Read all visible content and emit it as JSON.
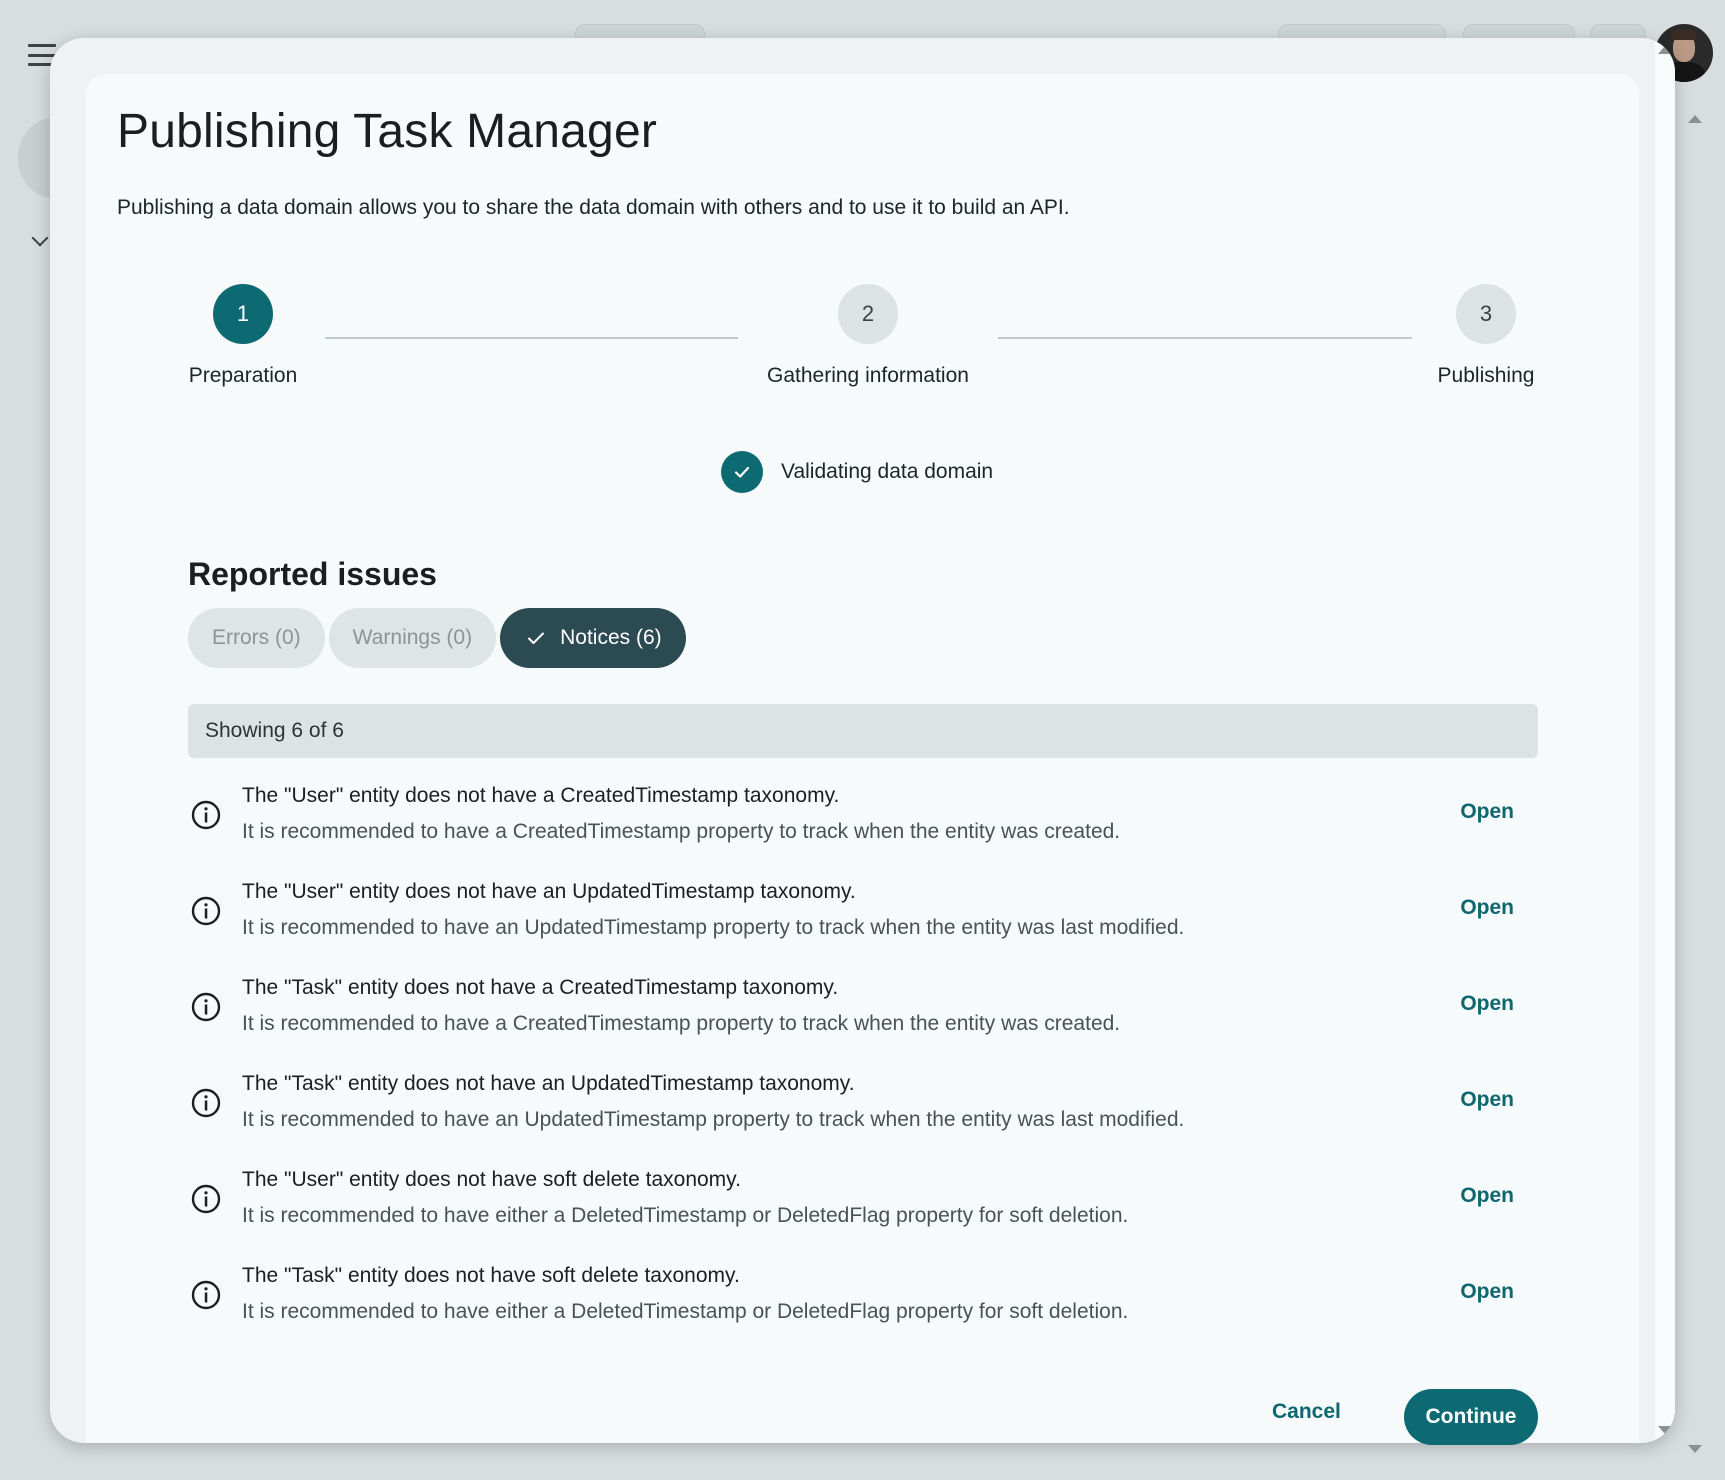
{
  "dialog": {
    "title": "Publishing Task Manager",
    "subtitle": "Publishing a data domain allows you to share the data domain with others and to use it to build an API."
  },
  "stepper": {
    "steps": [
      {
        "number": "1",
        "label": "Preparation",
        "state": "active"
      },
      {
        "number": "2",
        "label": "Gathering information",
        "state": "inactive"
      },
      {
        "number": "3",
        "label": "Publishing",
        "state": "inactive"
      }
    ]
  },
  "validation": {
    "label": "Validating data domain",
    "status": "complete"
  },
  "issues": {
    "title": "Reported issues",
    "filters": [
      {
        "label": "Errors (0)",
        "selected": false,
        "enabled": false
      },
      {
        "label": "Warnings (0)",
        "selected": false,
        "enabled": false
      },
      {
        "label": "Notices (6)",
        "selected": true,
        "enabled": true
      }
    ],
    "showing": "Showing 6 of 6",
    "open_label": "Open",
    "items": [
      {
        "title": "The \"User\" entity does not have a CreatedTimestamp taxonomy.",
        "detail": "It is recommended to have a CreatedTimestamp property to track when the entity was created."
      },
      {
        "title": "The \"User\" entity does not have an UpdatedTimestamp taxonomy.",
        "detail": "It is recommended to have an UpdatedTimestamp property to track when the entity was last modified."
      },
      {
        "title": "The \"Task\" entity does not have a CreatedTimestamp taxonomy.",
        "detail": "It is recommended to have a CreatedTimestamp property to track when the entity was created."
      },
      {
        "title": "The \"Task\" entity does not have an UpdatedTimestamp taxonomy.",
        "detail": "It is recommended to have an UpdatedTimestamp property to track when the entity was last modified."
      },
      {
        "title": "The \"User\" entity does not have soft delete taxonomy.",
        "detail": "It is recommended to have either a DeletedTimestamp or DeletedFlag property for soft deletion."
      },
      {
        "title": "The \"Task\" entity does not have soft delete taxonomy.",
        "detail": "It is recommended to have either a DeletedTimestamp or DeletedFlag property for soft deletion."
      }
    ]
  },
  "footer": {
    "cancel_label": "Cancel",
    "continue_label": "Continue"
  },
  "colors": {
    "primary": "#0e6a72",
    "selected_chip": "#2c4a52",
    "link": "#0d6670"
  }
}
